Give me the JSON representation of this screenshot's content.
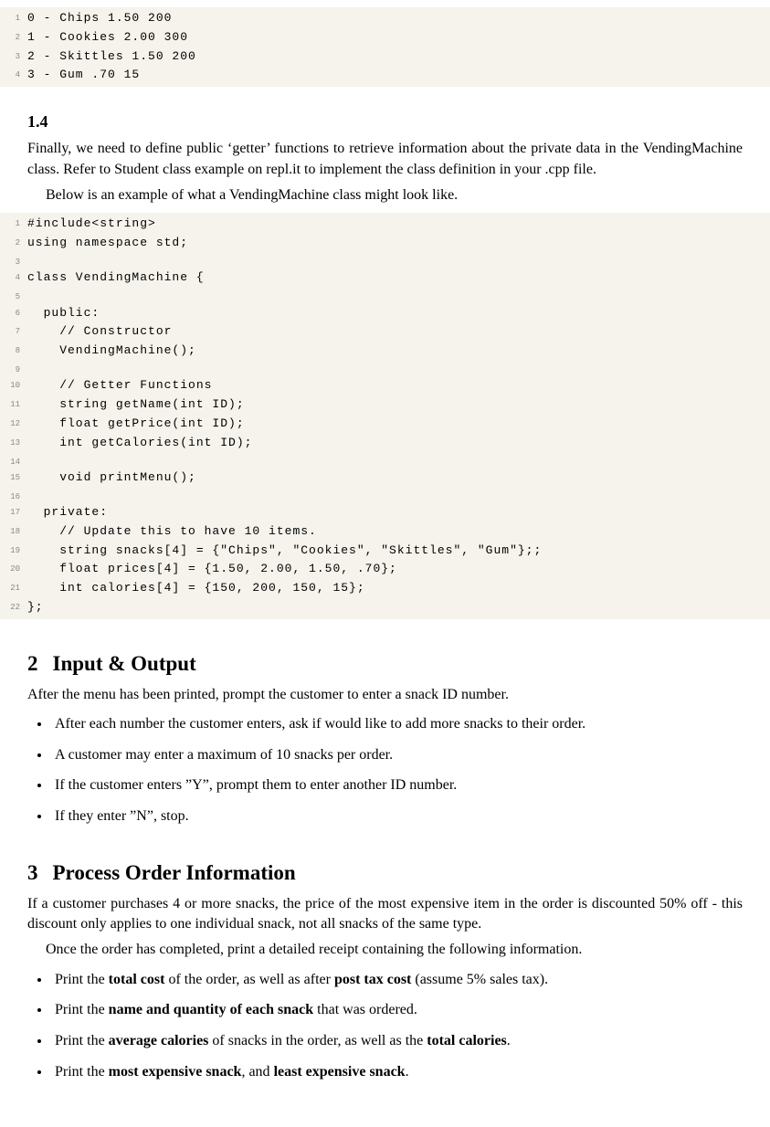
{
  "code1": {
    "lines": [
      "0 - Chips 1.50 200",
      "1 - Cookies 2.00 300",
      "2 - Skittles 1.50 200",
      "3 - Gum .70 15"
    ]
  },
  "sec14": {
    "heading": "1.4",
    "para1": "Finally, we need to define public ‘getter’ functions to retrieve information about the private data in the VendingMachine class. Refer to Student class example on repl.it to implement the class definition in your .cpp file.",
    "para2": "Below is an example of what a VendingMachine class might look like."
  },
  "code2": {
    "lines": [
      "#include<string>",
      "using namespace std;",
      "",
      "class VendingMachine {",
      "",
      "  public:",
      "    // Constructor",
      "    VendingMachine();",
      "",
      "    // Getter Functions",
      "    string getName(int ID);",
      "    float getPrice(int ID);",
      "    int getCalories(int ID);",
      "",
      "    void printMenu();",
      "",
      "  private:",
      "    // Update this to have 10 items.",
      "    string snacks[4] = {\"Chips\", \"Cookies\", \"Skittles\", \"Gum\"};;",
      "    float prices[4] = {1.50, 2.00, 1.50, .70};",
      "    int calories[4] = {150, 200, 150, 15};",
      "};"
    ]
  },
  "sec2": {
    "num": "2",
    "title": "Input & Output",
    "intro": "After the menu has been printed, prompt the customer to enter a snack ID number.",
    "bullets": [
      "After each number the customer enters, ask if would like to add more snacks to their order.",
      "A customer may enter a maximum of 10 snacks per order.",
      "If the customer enters ”Y”, prompt them to enter another ID number.",
      "If they enter ”N”, stop."
    ]
  },
  "sec3": {
    "num": "3",
    "title": "Process Order Information",
    "para1": "If a customer purchases 4 or more snacks, the price of the most expensive item in the order is discounted 50% off - this discount only applies to one individual snack, not all snacks of the same type.",
    "para2": "Once the order has completed, print a detailed receipt containing the following information.",
    "bullets": [
      {
        "pre": "Print the ",
        "b1": "total cost",
        "mid1": " of the order, as well as after ",
        "b2": "post tax cost",
        "post": " (assume 5% sales tax)."
      },
      {
        "pre": "Print the ",
        "b1": "name and quantity of each snack",
        "mid1": " that was ordered.",
        "b2": "",
        "post": ""
      },
      {
        "pre": "Print the ",
        "b1": "average calories",
        "mid1": " of snacks in the order, as well as the ",
        "b2": "total calories",
        "post": "."
      },
      {
        "pre": "Print the ",
        "b1": "most expensive snack",
        "mid1": ", and ",
        "b2": "least expensive snack",
        "post": "."
      }
    ]
  }
}
